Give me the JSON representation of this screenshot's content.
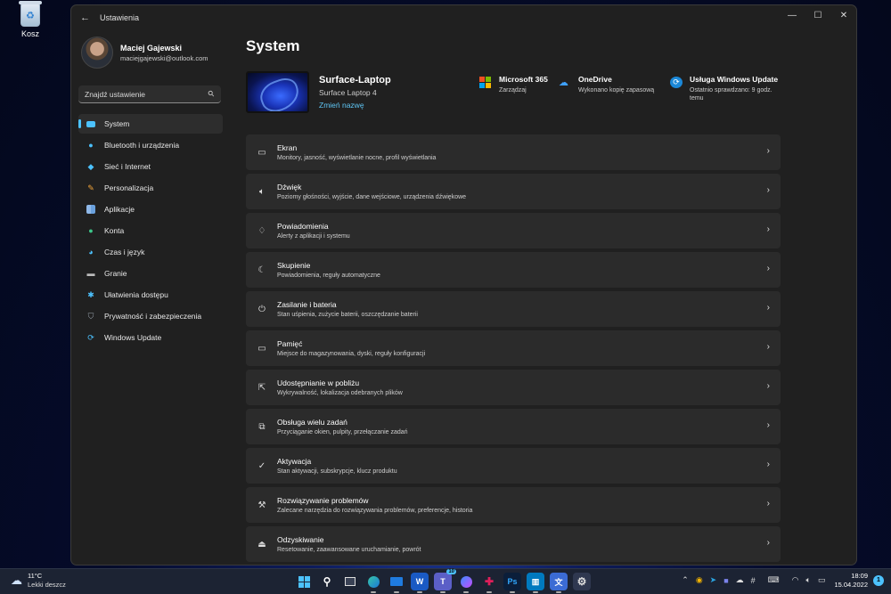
{
  "desktop": {
    "recycle_bin_label": "Kosz"
  },
  "window": {
    "title": "Ustawienia",
    "controls": {
      "minimize": "—",
      "maximize": "☐",
      "close": "✕"
    }
  },
  "profile": {
    "name": "Maciej Gajewski",
    "email": "maciejgajewski@outlook.com"
  },
  "search": {
    "placeholder": "Znajdź ustawienie"
  },
  "sidebar": {
    "items": [
      {
        "label": "System",
        "icon": "monitor-icon"
      },
      {
        "label": "Bluetooth i urządzenia",
        "icon": "bluetooth-icon"
      },
      {
        "label": "Sieć i Internet",
        "icon": "wifi-icon"
      },
      {
        "label": "Personalizacja",
        "icon": "brush-icon"
      },
      {
        "label": "Aplikacje",
        "icon": "apps-icon"
      },
      {
        "label": "Konta",
        "icon": "person-icon"
      },
      {
        "label": "Czas i język",
        "icon": "globe-clock-icon"
      },
      {
        "label": "Granie",
        "icon": "gamepad-icon"
      },
      {
        "label": "Ułatwienia dostępu",
        "icon": "accessibility-icon"
      },
      {
        "label": "Prywatność i zabezpieczenia",
        "icon": "shield-icon"
      },
      {
        "label": "Windows Update",
        "icon": "update-icon"
      }
    ]
  },
  "main": {
    "title": "System",
    "device": {
      "name": "Surface-Laptop",
      "model": "Surface Laptop 4",
      "rename": "Zmień nazwę"
    },
    "quick": [
      {
        "title": "Microsoft 365",
        "subtitle": "Zarządzaj",
        "icon": "microsoft-logo-icon"
      },
      {
        "title": "OneDrive",
        "subtitle": "Wykonano kopię zapasową",
        "icon": "cloud-icon"
      },
      {
        "title": "Usługa Windows Update",
        "subtitle": "Ostatnio sprawdzano: 9 godz. temu",
        "icon": "refresh-icon"
      }
    ],
    "settings": [
      {
        "title": "Ekran",
        "desc": "Monitory, jasność, wyświetlanie nocne, profil wyświetlania",
        "icon": "display-icon"
      },
      {
        "title": "Dźwięk",
        "desc": "Poziomy głośności, wyjście, dane wejściowe, urządzenia dźwiękowe",
        "icon": "speaker-icon"
      },
      {
        "title": "Powiadomienia",
        "desc": "Alerty z aplikacji i systemu",
        "icon": "bell-icon"
      },
      {
        "title": "Skupienie",
        "desc": "Powiadomienia, reguły automatyczne",
        "icon": "moon-icon"
      },
      {
        "title": "Zasilanie i bateria",
        "desc": "Stan uśpienia, zużycie baterii, oszczędzanie baterii",
        "icon": "power-icon"
      },
      {
        "title": "Pamięć",
        "desc": "Miejsce do magazynowania, dyski, reguły konfiguracji",
        "icon": "storage-icon"
      },
      {
        "title": "Udostępnianie w pobliżu",
        "desc": "Wykrywalność, lokalizacja odebranych plików",
        "icon": "share-icon"
      },
      {
        "title": "Obsługa wielu zadań",
        "desc": "Przyciąganie okien, pulpity, przełączanie zadań",
        "icon": "multitask-icon"
      },
      {
        "title": "Aktywacja",
        "desc": "Stan aktywacji, subskrypcje, klucz produktu",
        "icon": "check-circle-icon"
      },
      {
        "title": "Rozwiązywanie problemów",
        "desc": "Zalecane narzędzia do rozwiązywania problemów, preferencje, historia",
        "icon": "wrench-icon"
      },
      {
        "title": "Odzyskiwanie",
        "desc": "Resetowanie, zaawansowane uruchamianie, powrót",
        "icon": "recovery-icon"
      }
    ]
  },
  "taskbar": {
    "weather": {
      "temp": "11°C",
      "desc": "Lekki deszcz"
    },
    "clock": {
      "time": "18:09",
      "date": "15.04.2022"
    },
    "notification_count": "1",
    "teams_badge": "10"
  },
  "colors": {
    "accent": "#4cc2ff",
    "window_bg": "#202020",
    "card_bg": "#2b2b2b"
  }
}
